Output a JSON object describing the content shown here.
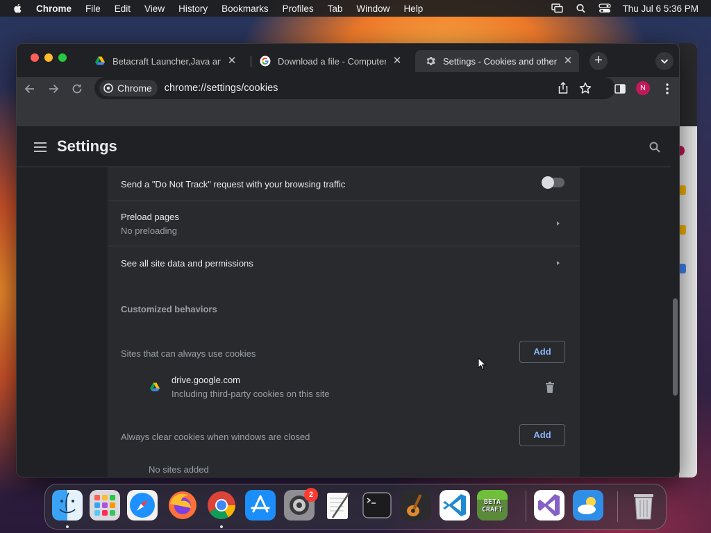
{
  "menubar": {
    "app_name": "Chrome",
    "items": [
      "File",
      "Edit",
      "View",
      "History",
      "Bookmarks",
      "Profiles",
      "Tab",
      "Window",
      "Help"
    ],
    "clock": "Thu Jul 6  5:36 PM"
  },
  "tabs": [
    {
      "title": "Betacraft Launcher,Java and",
      "icon": "google-drive-icon",
      "active": false
    },
    {
      "title": "Download a file - Computer -",
      "icon": "google-g-icon",
      "active": false
    },
    {
      "title": "Settings - Cookies and other",
      "icon": "gear-icon",
      "active": true
    }
  ],
  "omnibox": {
    "chip_label": "Chrome",
    "url": "chrome://settings/cookies"
  },
  "profile": {
    "initial": "N",
    "color": "#c2185b"
  },
  "settings": {
    "title": "Settings",
    "do_not_track": {
      "label": "Send a \"Do Not Track\" request with your browsing traffic",
      "enabled": false
    },
    "preload": {
      "label": "Preload pages",
      "value": "No preloading"
    },
    "site_data": {
      "label": "See all site data and permissions"
    },
    "customized_behaviors": "Customized behaviors",
    "always_allow": {
      "label": "Sites that can always use cookies",
      "add_label": "Add",
      "sites": [
        {
          "domain": "drive.google.com",
          "detail": "Including third-party cookies on this site",
          "icon": "google-drive-icon"
        }
      ]
    },
    "clear_on_close": {
      "label": "Always clear cookies when windows are closed",
      "add_label": "Add",
      "empty": "No sites added"
    }
  },
  "dock": {
    "apps": [
      "finder-icon",
      "launchpad-icon",
      "safari-icon",
      "firefox-icon",
      "chrome-icon",
      "app-store-icon",
      "system-settings-icon",
      "textedit-icon",
      "terminal-icon",
      "garageband-icon",
      "vscode-icon",
      "betacraft-icon",
      "visual-studio-icon",
      "weather-icon",
      "trash-icon"
    ],
    "system_settings_badge": "2",
    "betacraft_label": "BETA CRAFT"
  },
  "colors": {
    "accent": "#8ab4f8",
    "page_bg": "#202124",
    "card_bg": "#292a2d"
  }
}
